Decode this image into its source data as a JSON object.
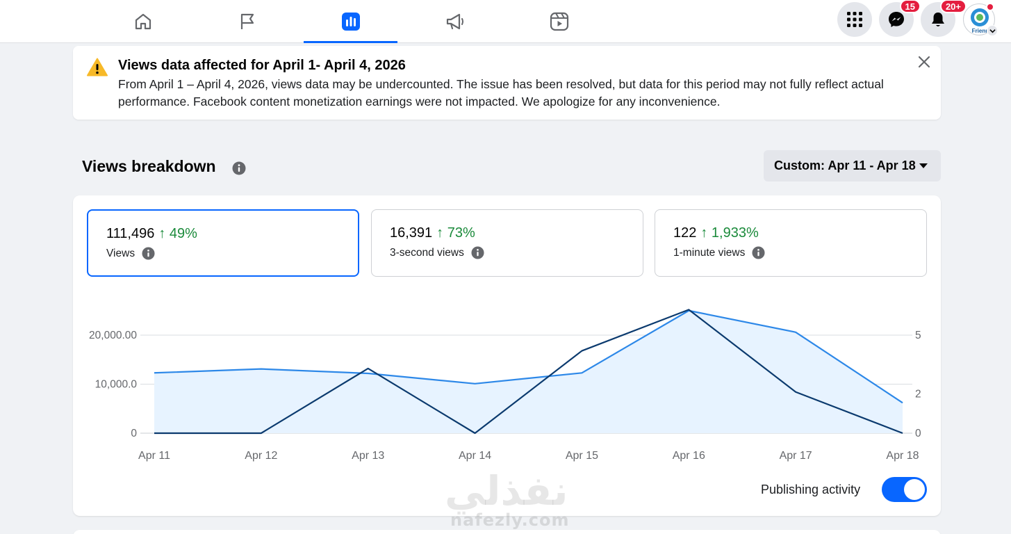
{
  "nav": {
    "tabs": [
      {
        "icon": "home-icon"
      },
      {
        "icon": "flag-icon"
      },
      {
        "icon": "insights-icon",
        "active": true
      },
      {
        "icon": "megaphone-icon"
      },
      {
        "icon": "reels-icon"
      }
    ],
    "menu_icon": "grid-menu-icon",
    "messenger": {
      "icon": "messenger-icon",
      "badge": "15"
    },
    "notifications": {
      "icon": "bell-icon",
      "badge": "20+"
    },
    "avatar_text": "Frienr"
  },
  "alert": {
    "title": "Views data affected for April 1- April 4, 2026",
    "body": "From April 1 – April 4, 2026, views data may be undercounted. The issue has been resolved, but data for this period may not fully reflect actual performance. Facebook content monetization earnings were not impacted. We apologize for any inconvenience.",
    "warning_color": "#f7b928"
  },
  "section": {
    "title": "Views breakdown",
    "date_range": "Custom: Apr 11 - Apr 18"
  },
  "metrics": [
    {
      "value": "111,496",
      "change": "↑ 49%",
      "label": "Views",
      "selected": true
    },
    {
      "value": "16,391",
      "change": "↑ 73%",
      "label": "3-second views",
      "selected": false
    },
    {
      "value": "122",
      "change": "↑ 1,933%",
      "label": "1-minute views",
      "selected": false
    }
  ],
  "publishing_activity": {
    "label": "Publishing activity",
    "enabled": true
  },
  "watermark": {
    "arabic": "نفذلي",
    "latin": "nafezly.com"
  },
  "colors": {
    "accent": "#0866ff",
    "positive": "#1a8a3a",
    "views_line": "#2d88e8",
    "activity_line": "#0b3a6e",
    "area_fill": "#e7f3ff"
  },
  "chart_data": {
    "type": "line",
    "categories": [
      "Apr 11",
      "Apr 12",
      "Apr 13",
      "Apr 14",
      "Apr 15",
      "Apr 16",
      "Apr 17",
      "Apr 18"
    ],
    "y_left_ticks": [
      "0",
      "10,000.0",
      "20,000.00"
    ],
    "y_right_ticks": [
      "0",
      "2",
      "5"
    ],
    "ylim_left": [
      0,
      20000
    ],
    "ylim_right": [
      0,
      5
    ],
    "series": [
      {
        "axis": "left",
        "type": "area",
        "values": [
          12300,
          13100,
          12200,
          10100,
          12300,
          25000,
          20600,
          6200
        ]
      },
      {
        "axis": "right",
        "type": "line",
        "values": [
          0,
          0,
          3.3,
          0,
          4.2,
          6.3,
          2.1,
          0
        ]
      }
    ],
    "grid": true,
    "legend": "none"
  }
}
